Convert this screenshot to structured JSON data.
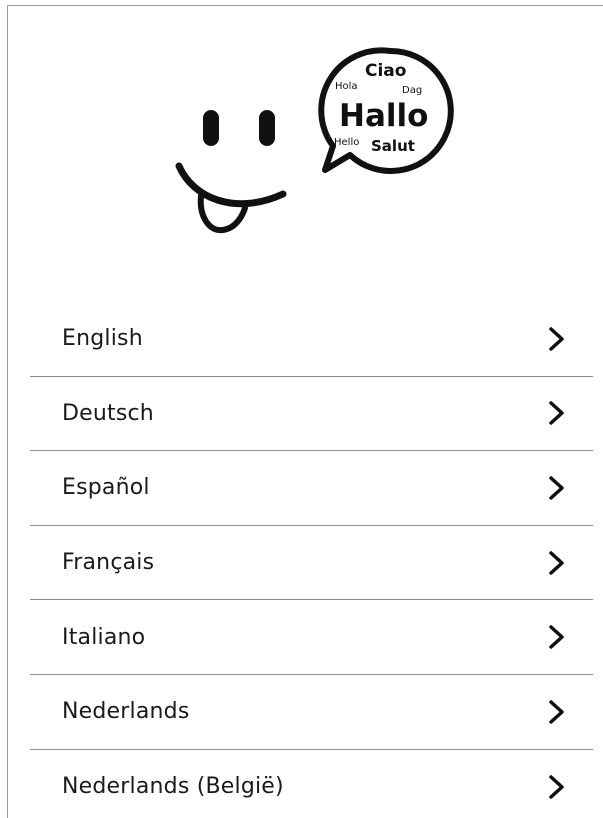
{
  "hero": {
    "greetings": {
      "ciao": "Ciao",
      "hola": "Hola",
      "dag": "Dag",
      "hallo": "Hallo",
      "hello": "Hello",
      "salut": "Salut"
    }
  },
  "languages": [
    {
      "label": "English",
      "icon": "chevron-right-icon"
    },
    {
      "label": "Deutsch",
      "icon": "chevron-right-icon"
    },
    {
      "label": "Español",
      "icon": "chevron-right-icon"
    },
    {
      "label": "Français",
      "icon": "chevron-right-icon"
    },
    {
      "label": "Italiano",
      "icon": "chevron-right-icon"
    },
    {
      "label": "Nederlands",
      "icon": "chevron-right-icon"
    },
    {
      "label": "Nederlands (België)",
      "icon": "chevron-right-icon"
    }
  ]
}
